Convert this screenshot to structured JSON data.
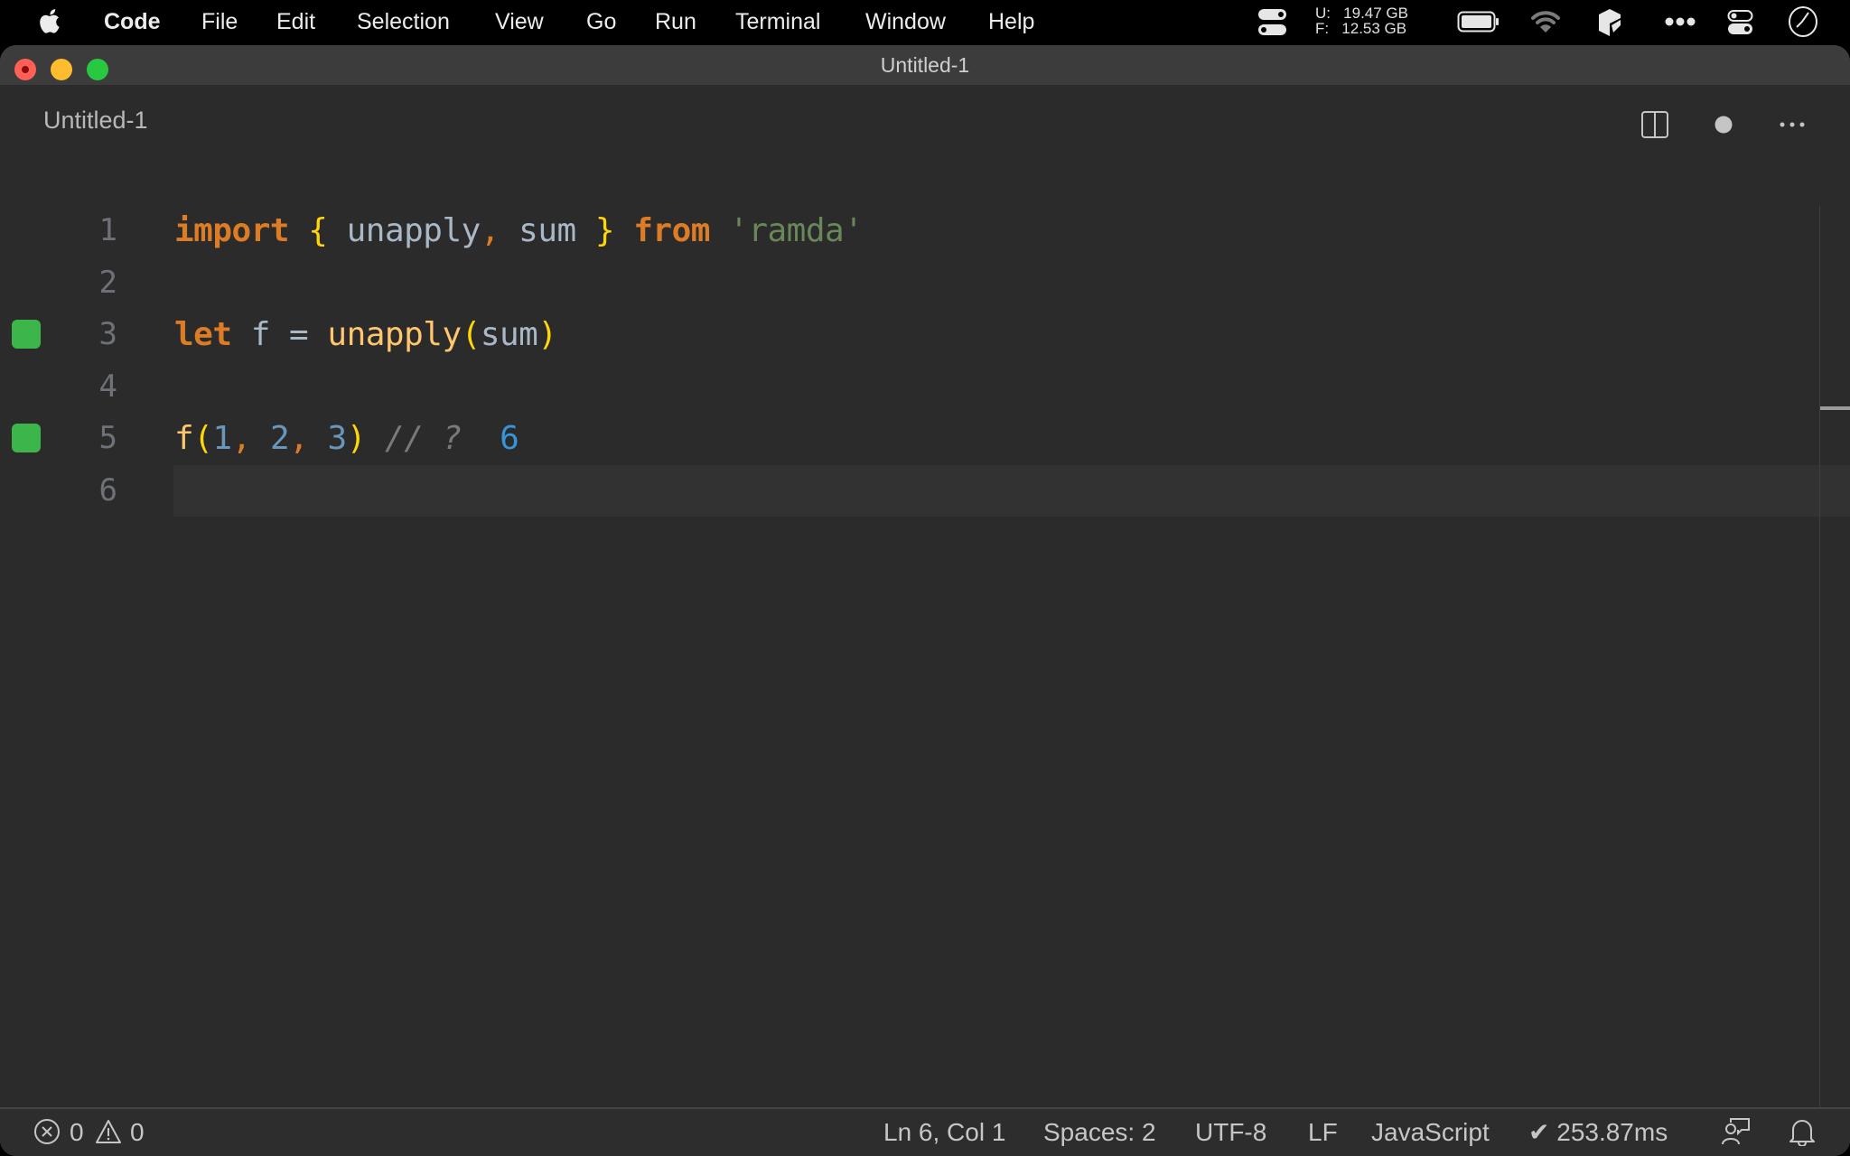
{
  "menubar": {
    "apple_icon": "apple-logo-icon",
    "app_name": "Code",
    "items": [
      "File",
      "Edit",
      "Selection",
      "View",
      "Go",
      "Run",
      "Terminal",
      "Window",
      "Help"
    ],
    "memory": {
      "used_label": "U:",
      "used_value": "19.47 GB",
      "free_label": "F:",
      "free_value": "12.53 GB"
    },
    "tray_icons": [
      "toggle-icon",
      "battery-icon",
      "wifi-icon",
      "cube-app-icon",
      "more-dots-icon",
      "control-center-icon",
      "clock-icon"
    ]
  },
  "window": {
    "title": "Untitled-1",
    "traffic_lights": [
      "close",
      "minimize",
      "zoom"
    ]
  },
  "editor_tab": {
    "label": "Untitled-1",
    "actions": [
      "split-editor-icon",
      "unsaved-dot-icon",
      "more-actions-icon"
    ]
  },
  "editor": {
    "current_line": 6,
    "lines": [
      {
        "number": "1",
        "marker": false,
        "tokens": [
          {
            "t": "import",
            "c": "kw"
          },
          {
            "t": " ",
            "c": "id"
          },
          {
            "t": "{",
            "c": "brace"
          },
          {
            "t": " unapply",
            "c": "id"
          },
          {
            "t": ",",
            "c": "punc"
          },
          {
            "t": " sum ",
            "c": "id"
          },
          {
            "t": "}",
            "c": "brace"
          },
          {
            "t": " ",
            "c": "id"
          },
          {
            "t": "from",
            "c": "kw"
          },
          {
            "t": " ",
            "c": "id"
          },
          {
            "t": "'ramda'",
            "c": "str"
          }
        ]
      },
      {
        "number": "2",
        "marker": false,
        "tokens": []
      },
      {
        "number": "3",
        "marker": true,
        "tokens": [
          {
            "t": "let",
            "c": "kw"
          },
          {
            "t": " f = ",
            "c": "id"
          },
          {
            "t": "unapply",
            "c": "fn"
          },
          {
            "t": "(",
            "c": "brace"
          },
          {
            "t": "sum",
            "c": "id"
          },
          {
            "t": ")",
            "c": "brace"
          }
        ]
      },
      {
        "number": "4",
        "marker": false,
        "tokens": []
      },
      {
        "number": "5",
        "marker": true,
        "tokens": [
          {
            "t": "f",
            "c": "fn"
          },
          {
            "t": "(",
            "c": "brace"
          },
          {
            "t": "1",
            "c": "num"
          },
          {
            "t": ",",
            "c": "punc"
          },
          {
            "t": " ",
            "c": "id"
          },
          {
            "t": "2",
            "c": "num"
          },
          {
            "t": ",",
            "c": "punc"
          },
          {
            "t": " ",
            "c": "id"
          },
          {
            "t": "3",
            "c": "num"
          },
          {
            "t": ")",
            "c": "brace"
          },
          {
            "t": " // ?",
            "c": "cmt"
          },
          {
            "t": "  6",
            "c": "res"
          }
        ]
      },
      {
        "number": "6",
        "marker": false,
        "tokens": []
      }
    ],
    "colors": {
      "keyword": "#dc7d26",
      "brace": "#ffd60a",
      "identifier": "#a9b7c6",
      "string": "#6a8759",
      "function": "#ffc66d",
      "number": "#6897bb",
      "comment": "#7a7a7a",
      "inline_result": "#3794d6",
      "coverage_marker": "#3cb64a"
    }
  },
  "statusbar": {
    "errors": "0",
    "warnings": "0",
    "cursor": "Ln 6, Col 1",
    "indent": "Spaces: 2",
    "encoding": "UTF-8",
    "eol": "LF",
    "language": "JavaScript",
    "timing": "✔ 253.87ms"
  }
}
